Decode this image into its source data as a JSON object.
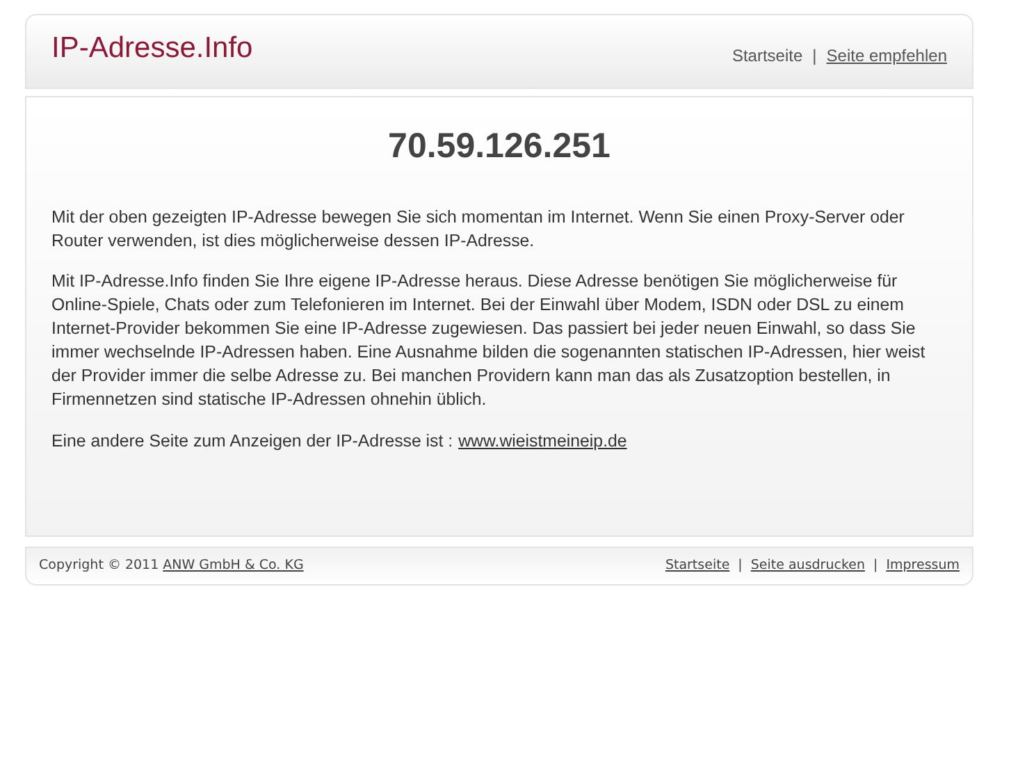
{
  "header": {
    "logo": "IP-Adresse.Info",
    "nav": [
      {
        "kind": "text",
        "label": "Startseite"
      },
      {
        "kind": "separator",
        "label": "|"
      },
      {
        "kind": "link",
        "label": "Seite empfehlen"
      }
    ]
  },
  "main": {
    "ip": "70.59.126.251",
    "paragraphs": [
      "Mit der oben gezeigten IP-Adresse bewegen Sie sich momentan im Internet. Wenn Sie einen Proxy-Server oder Router verwenden, ist dies möglicherweise dessen IP-Adresse.",
      "Mit IP-Adresse.Info finden Sie Ihre eigene IP-Adresse heraus. Diese Adresse benötigen Sie möglicherweise für Online-Spiele, Chats oder zum Telefonieren im Internet. Bei der Einwahl über Modem, ISDN oder DSL zu einem Internet-Provider bekommen Sie eine IP-Adresse zugewiesen. Das passiert bei jeder neuen Einwahl, so dass Sie immer wechselnde IP-Adressen haben. Eine Ausnahme bilden die sogenannten statischen IP-Adressen, hier weist der Provider immer die selbe Adresse zu. Bei manchen Providern kann man das als Zusatzoption bestellen, in Firmennetzen sind statische IP-Adressen ohnehin üblich."
    ],
    "other_site": {
      "text": "Eine andere Seite zum Anzeigen der IP-Adresse ist :",
      "link": "www.wieistmeineip.de"
    }
  },
  "footer": {
    "copyright": "Copyright © 2011",
    "company_link": "ANW GmbH & Co. KG",
    "nav": [
      {
        "kind": "link",
        "label": "Startseite"
      },
      {
        "kind": "separator",
        "label": "|"
      },
      {
        "kind": "link",
        "label": "Seite ausdrucken"
      },
      {
        "kind": "separator",
        "label": "|"
      },
      {
        "kind": "link",
        "label": "Impressum"
      }
    ]
  }
}
